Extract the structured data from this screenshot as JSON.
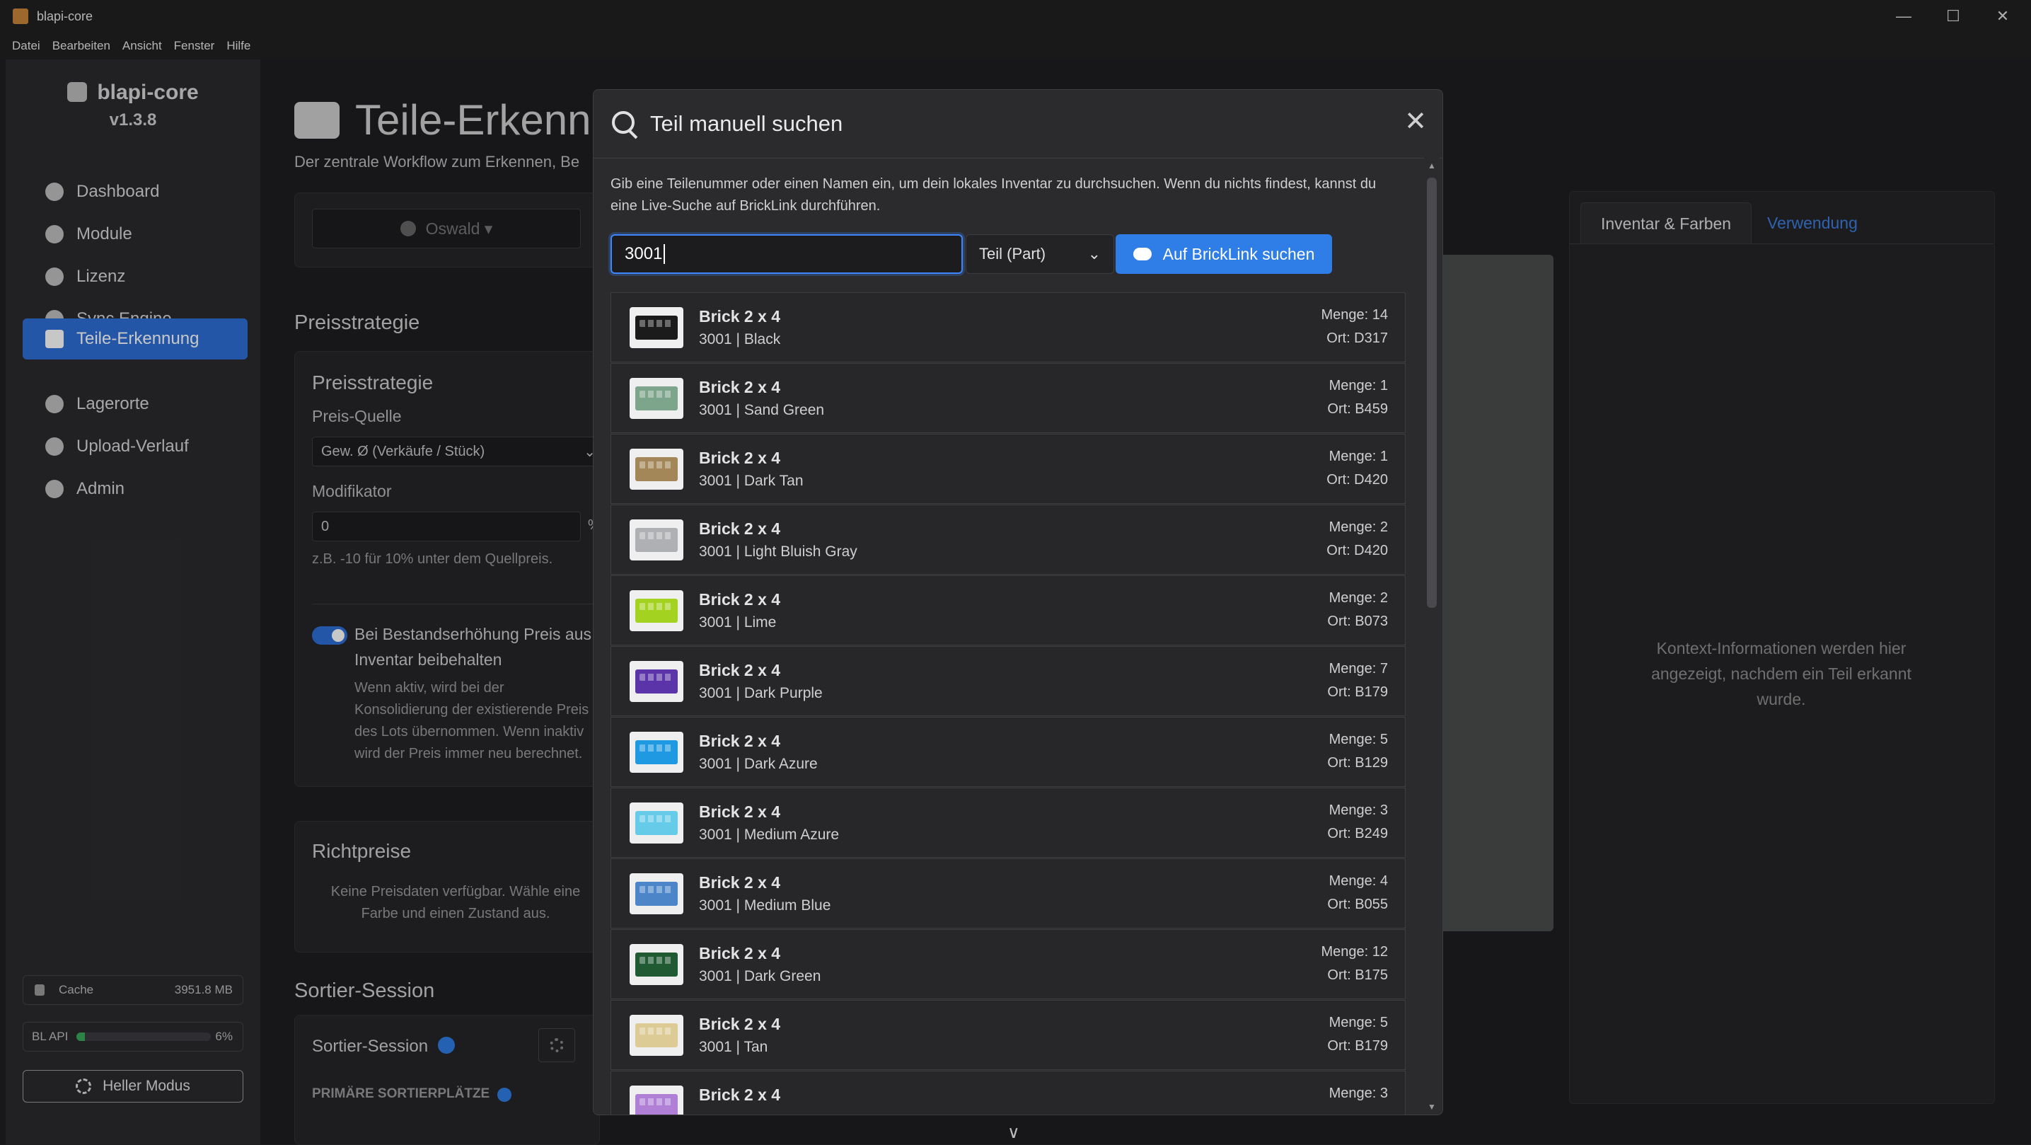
{
  "window": {
    "title": "blapi-core",
    "minimize": "—",
    "maximize": "☐",
    "close": "✕"
  },
  "menu": [
    "Datei",
    "Bearbeiten",
    "Ansicht",
    "Fenster",
    "Hilfe"
  ],
  "sidebar": {
    "app_name": "blapi-core",
    "version": "v1.3.8",
    "items": [
      {
        "label": "Dashboard",
        "icon": "dashboard-icon"
      },
      {
        "label": "Module",
        "icon": "puzzle-icon"
      },
      {
        "label": "Lizenz",
        "icon": "license-icon"
      },
      {
        "label": "Sync Engine",
        "icon": "gears-icon"
      },
      {
        "label": "Teile-Erkennung",
        "icon": "camera-icon",
        "active": true
      },
      {
        "label": "Lagerorte",
        "icon": "storage-icon"
      },
      {
        "label": "Upload-Verlauf",
        "icon": "history-icon"
      },
      {
        "label": "Admin",
        "icon": "shield-icon"
      }
    ],
    "cache_label": "Cache",
    "cache_value": "3951.8 MB",
    "api_label": "BL API",
    "api_value": "6%",
    "api_fraction": 0.06,
    "mode_button": "Heller Modus"
  },
  "page": {
    "title": "Teile-Erkenn",
    "subtitle": "Der zentrale Workflow zum Erkennen, Be",
    "user_select": "Oswald ▾",
    "section_price": "Preisstrategie",
    "card_price_title": "Preisstrategie",
    "price_source_label": "Preis-Quelle",
    "price_source_value": "Gew. Ø (Verkäufe / Stück)",
    "modifier_label": "Modifikator",
    "modifier_value": "0",
    "modifier_unit": "%",
    "modifier_hint": "z.B. -10 für 10% unter dem Quellpreis.",
    "toggle_label_1": "Bei Bestandserhöhung Preis aus",
    "toggle_label_2": "Inventar beibehalten",
    "toggle_help": [
      "Wenn aktiv, wird bei der",
      "Konsolidierung der existierende Preis",
      "des Lots übernommen. Wenn inaktiv",
      "wird der Preis immer neu berechnet."
    ],
    "card_richt_title": "Richtpreise",
    "richt_text": [
      "Keine Preisdaten verfügbar. Wähle eine",
      "Farbe und einen Zustand aus."
    ],
    "section_sort": "Sortier-Session",
    "card_sort_title": "Sortier-Session",
    "sort_primary": "PRIMÄRE SORTIERPLÄTZE"
  },
  "right_panel": {
    "tabs": [
      "Inventar & Farben",
      "Verwendung"
    ],
    "context_text": "Kontext-Informationen werden hier angezeigt, nachdem ein Teil erkannt wurde."
  },
  "modal": {
    "title": "Teil manuell suchen",
    "description": "Gib eine Teilenummer oder einen Namen ein, um dein lokales Inventar zu durchsuchen. Wenn du nichts findest, kannst du eine Live-Suche auf BrickLink durchführen.",
    "search_value": "3001",
    "type_select": "Teil (Part)",
    "bricklink_button": "Auf BrickLink suchen",
    "results": [
      {
        "name": "Brick 2 x 4",
        "sub": "3001 | Black",
        "qty": "Menge: 14",
        "loc": "Ort: D317",
        "color": "#1b1b1b"
      },
      {
        "name": "Brick 2 x 4",
        "sub": "3001 | Sand Green",
        "qty": "Menge: 1",
        "loc": "Ort: B459",
        "color": "#7da58c"
      },
      {
        "name": "Brick 2 x 4",
        "sub": "3001 | Dark Tan",
        "qty": "Menge: 1",
        "loc": "Ort: D420",
        "color": "#a38758"
      },
      {
        "name": "Brick 2 x 4",
        "sub": "3001 | Light Bluish Gray",
        "qty": "Menge: 2",
        "loc": "Ort: D420",
        "color": "#aeb0b3"
      },
      {
        "name": "Brick 2 x 4",
        "sub": "3001 | Lime",
        "qty": "Menge: 2",
        "loc": "Ort: B073",
        "color": "#a3d220"
      },
      {
        "name": "Brick 2 x 4",
        "sub": "3001 | Dark Purple",
        "qty": "Menge: 7",
        "loc": "Ort: B179",
        "color": "#5a34a8"
      },
      {
        "name": "Brick 2 x 4",
        "sub": "3001 | Dark Azure",
        "qty": "Menge: 5",
        "loc": "Ort: B129",
        "color": "#1f9ae2"
      },
      {
        "name": "Brick 2 x 4",
        "sub": "3001 | Medium Azure",
        "qty": "Menge: 3",
        "loc": "Ort: B249",
        "color": "#66cbe8"
      },
      {
        "name": "Brick 2 x 4",
        "sub": "3001 | Medium Blue",
        "qty": "Menge: 4",
        "loc": "Ort: B055",
        "color": "#4c86c9"
      },
      {
        "name": "Brick 2 x 4",
        "sub": "3001 | Dark Green",
        "qty": "Menge: 12",
        "loc": "Ort: B175",
        "color": "#1f5a33"
      },
      {
        "name": "Brick 2 x 4",
        "sub": "3001 | Tan",
        "qty": "Menge: 5",
        "loc": "Ort: B179",
        "color": "#dccb95"
      },
      {
        "name": "Brick 2 x 4",
        "sub": "",
        "qty": "Menge: 3",
        "loc": "",
        "color": "#b07fd6"
      }
    ]
  },
  "colors": {
    "accent": "#2f6fd6",
    "button_blue": "#2f7de6",
    "focus_border": "#3d86ff",
    "link_blue": "#3d7ee0"
  }
}
